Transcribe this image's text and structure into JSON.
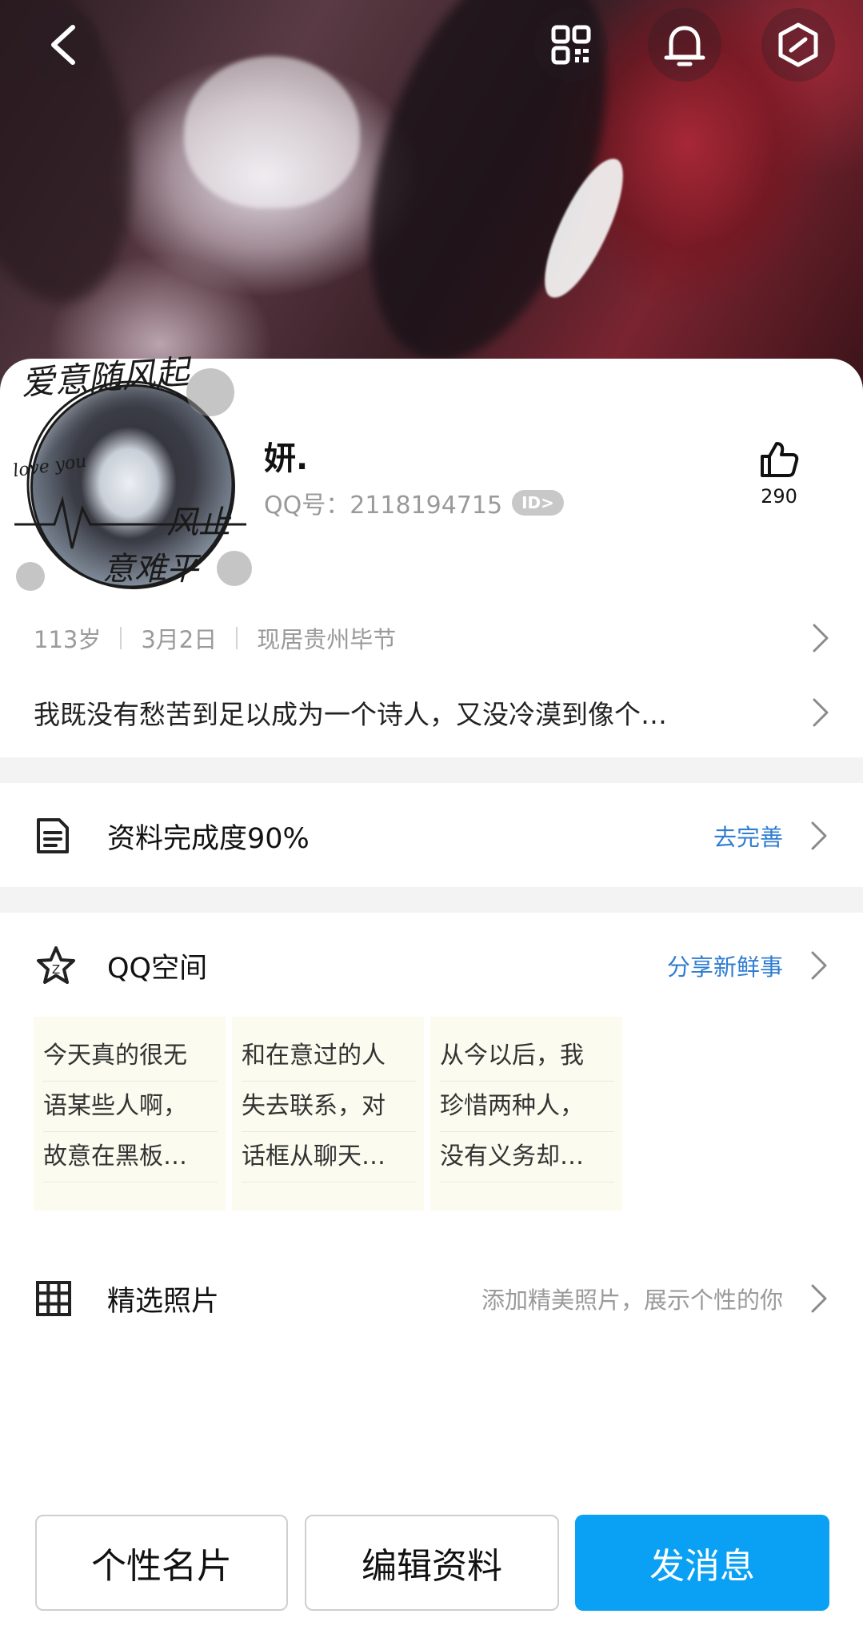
{
  "header": {
    "back_icon": "back-arrow-icon",
    "qr_icon": "qr-code-icon",
    "bell_icon": "bell-icon",
    "settings_icon": "hexagon-settings-icon"
  },
  "avatar": {
    "text_1": "爱意随风起",
    "text_2": "love you",
    "text_3": "风止",
    "text_4": "意难平"
  },
  "profile": {
    "name": "妍.",
    "qq_label": "QQ号：2118194715",
    "id_badge": "ID>",
    "likes": "290"
  },
  "meta": {
    "age": "113岁",
    "birthday": "3月2日",
    "location": "现居贵州毕节"
  },
  "signature": "我既没有愁苦到足以成为一个诗人，又没冷漠到像个…",
  "completion": {
    "label": "资料完成度90%",
    "action": "去完善"
  },
  "qzone": {
    "label": "QQ空间",
    "action": "分享新鲜事",
    "posts": [
      {
        "lines": [
          "今天真的很无",
          "语某些人啊，",
          "故意在黑板…"
        ]
      },
      {
        "lines": [
          "和在意过的人",
          "失去联系，对",
          "话框从聊天…"
        ]
      },
      {
        "lines": [
          "从今以后，我",
          "珍惜两种人，",
          "没有义务却…"
        ]
      }
    ]
  },
  "photos": {
    "label": "精选照片",
    "hint": "添加精美照片，展示个性的你"
  },
  "buttons": {
    "card": "个性名片",
    "edit": "编辑资料",
    "message": "发消息"
  },
  "colors": {
    "accent_blue": "#0aa1f5",
    "link_blue": "#2f7ed1"
  }
}
